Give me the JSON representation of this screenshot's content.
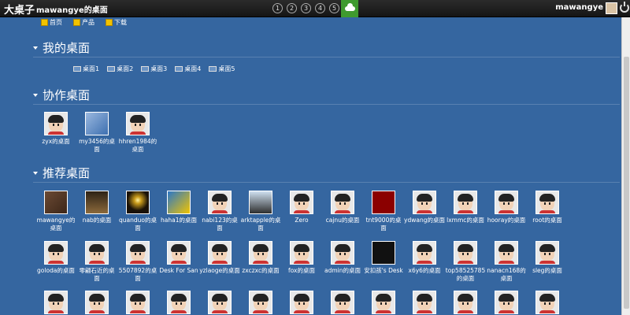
{
  "topbar": {
    "brand": "大桌子",
    "desk_title": "mawangye的桌面",
    "pages": [
      "1",
      "2",
      "3",
      "4",
      "5"
    ],
    "user": "mawangye"
  },
  "nav": [
    {
      "label": "首页",
      "icon": "home-icon"
    },
    {
      "label": "产品",
      "icon": "product-icon"
    },
    {
      "label": "下载",
      "icon": "download-icon"
    }
  ],
  "sections": {
    "mine": "我的桌面",
    "collab": "协作桌面",
    "recommended": "推荐桌面"
  },
  "my_desks": [
    "桌面1",
    "桌面2",
    "桌面3",
    "桌面4",
    "桌面5"
  ],
  "collab_desks": [
    {
      "name": "zyx的桌面",
      "thumb": "avatar"
    },
    {
      "name": "my3456的桌面",
      "thumb": "blue"
    },
    {
      "name": "hhren1984的桌面",
      "thumb": "avatar"
    }
  ],
  "recommended_row1": [
    {
      "name": "mawangye的桌面",
      "thumb": "woman"
    },
    {
      "name": "nab的桌面",
      "thumb": "city"
    },
    {
      "name": "quanduo的桌面",
      "thumb": "light"
    },
    {
      "name": "haha1的桌面",
      "thumb": "sky"
    },
    {
      "name": "nabi123的桌面",
      "thumb": "avatar"
    },
    {
      "name": "arktapple的桌面",
      "thumb": "penguin"
    },
    {
      "name": "Zero",
      "thumb": "avatar"
    },
    {
      "name": "cajnu的桌面",
      "thumb": "avatar"
    },
    {
      "name": "tnt9000的桌面",
      "thumb": "red"
    },
    {
      "name": "ydwang的桌面",
      "thumb": "avatar"
    },
    {
      "name": "lxmmc的桌面",
      "thumb": "avatar"
    },
    {
      "name": "hooray的桌面",
      "thumb": "avatar"
    },
    {
      "name": "root的桌面",
      "thumb": "avatar"
    }
  ],
  "recommended_row2": [
    {
      "name": "goloda的桌面",
      "thumb": "avatar"
    },
    {
      "name": "零翩石近的桌面",
      "thumb": "avatar"
    },
    {
      "name": "5507892的桌面",
      "thumb": "avatar"
    },
    {
      "name": "Desk For San",
      "thumb": "avatar"
    },
    {
      "name": "yzlaoge的桌面",
      "thumb": "avatar"
    },
    {
      "name": "zxczxc的桌面",
      "thumb": "avatar"
    },
    {
      "name": "fox的桌面",
      "thumb": "avatar"
    },
    {
      "name": "admin的桌面",
      "thumb": "avatar"
    },
    {
      "name": "安扣孩's Desk",
      "thumb": "dark"
    },
    {
      "name": "x6y6的桌面",
      "thumb": "avatar"
    },
    {
      "name": "top58525785的桌面",
      "thumb": "avatar"
    },
    {
      "name": "nanacn168的桌面",
      "thumb": "avatar"
    },
    {
      "name": "sleg的桌面",
      "thumb": "avatar"
    }
  ],
  "recommended_row3_count": 13,
  "colors": {
    "background": "#3566a0",
    "topbar": "#1c1c1c",
    "active_page": "#3f9a2e"
  }
}
